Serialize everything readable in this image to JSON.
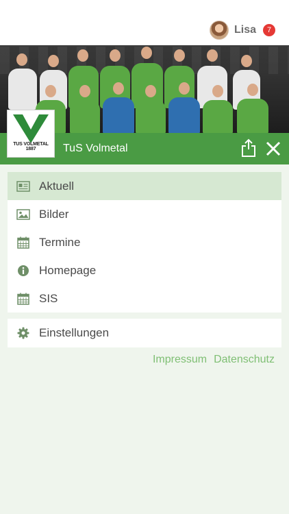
{
  "user": {
    "name": "Lisa",
    "notifications": "7"
  },
  "club": {
    "name": "TuS Volmetal",
    "logo_text": "TUS VOLMETAL 1887"
  },
  "menu": {
    "items": [
      {
        "label": "Aktuell",
        "icon": "newspaper-icon",
        "active": true
      },
      {
        "label": "Bilder",
        "icon": "image-icon",
        "active": false
      },
      {
        "label": "Termine",
        "icon": "calendar-icon",
        "active": false
      },
      {
        "label": "Homepage",
        "icon": "info-icon",
        "active": false
      },
      {
        "label": "SIS",
        "icon": "calendar-icon",
        "active": false
      }
    ],
    "settings": {
      "label": "Einstellungen",
      "icon": "gear-icon"
    }
  },
  "footer": {
    "impressum": "Impressum",
    "datenschutz": "Datenschutz"
  },
  "colors": {
    "accent": "#4a9b44",
    "active_bg": "#d6e8d2",
    "link": "#7fbf74",
    "badge": "#e53935",
    "page_bg": "#eff5ed"
  }
}
